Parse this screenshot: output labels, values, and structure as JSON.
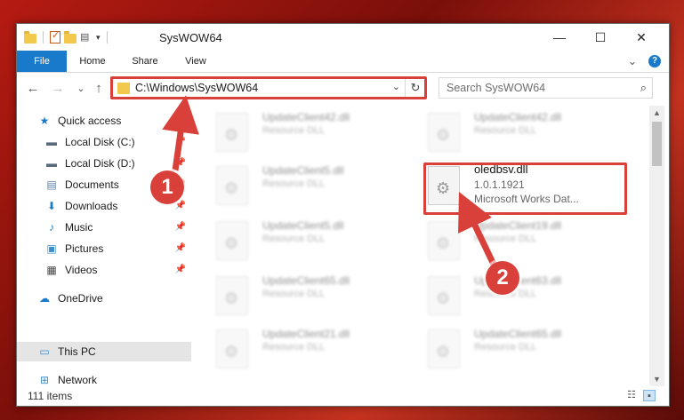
{
  "window": {
    "title": "SysWOW64"
  },
  "window_controls": {
    "minimize": "—",
    "maximize": "☐",
    "close": "✕"
  },
  "ribbon": {
    "tabs": [
      "File",
      "Home",
      "Share",
      "View"
    ],
    "expand_glyph": "⌄",
    "help_glyph": "?"
  },
  "nav": {
    "back": "←",
    "forward": "→",
    "recent": "⌄",
    "up": "↑"
  },
  "address": {
    "path": "C:\\Windows\\SysWOW64",
    "dropdown": "⌄",
    "refresh": "↻"
  },
  "search": {
    "placeholder": "Search SysWOW64",
    "icon": "⌕"
  },
  "sidebar": {
    "items": [
      {
        "label": "Quick access",
        "icon": "star-icon",
        "glyph": "★",
        "color": "#1979ca"
      },
      {
        "label": "Local Disk (C:)",
        "icon": "drive-icon",
        "glyph": "▬",
        "color": "#5a6b7a",
        "pinned": "📌"
      },
      {
        "label": "Local Disk (D:)",
        "icon": "drive-icon",
        "glyph": "▬",
        "color": "#5a6b7a",
        "pinned": "📌"
      },
      {
        "label": "Documents",
        "icon": "documents-icon",
        "glyph": "▤",
        "color": "#5b7fa6",
        "pinned": "📌"
      },
      {
        "label": "Downloads",
        "icon": "download-icon",
        "glyph": "⬇",
        "color": "#1979ca",
        "pinned": "📌"
      },
      {
        "label": "Music",
        "icon": "music-icon",
        "glyph": "♪",
        "color": "#1979ca",
        "pinned": "📌"
      },
      {
        "label": "Pictures",
        "icon": "pictures-icon",
        "glyph": "▣",
        "color": "#3a8fd0",
        "pinned": "📌"
      },
      {
        "label": "Videos",
        "icon": "videos-icon",
        "glyph": "▦",
        "color": "#444",
        "pinned": "📌"
      },
      {
        "label": "OneDrive",
        "icon": "cloud-icon",
        "glyph": "☁",
        "color": "#1979ca"
      },
      {
        "label": "This PC",
        "icon": "computer-icon",
        "glyph": "▭",
        "color": "#3a8fd0"
      },
      {
        "label": "Network",
        "icon": "network-icon",
        "glyph": "⊞",
        "color": "#3a8fd0"
      }
    ]
  },
  "files": {
    "left": [
      {
        "name": "UpdateClient42.dll",
        "desc": "Resource DLL"
      },
      {
        "name": "UpdateClient5.dll",
        "desc": "Resource DLL"
      },
      {
        "name": "UpdateClient5.dll",
        "desc": "Resource DLL"
      },
      {
        "name": "UpdateClient65.dll",
        "desc": "Resource DLL"
      },
      {
        "name": "UpdateClient21.dll",
        "desc": "Resource DLL"
      }
    ],
    "right": [
      {
        "name": "UpdateClient42.dll",
        "desc": "Resource DLL"
      },
      {
        "name": "UpdateClient19.dll",
        "desc": "Resource DLL"
      },
      {
        "name": "UpdateClient63.dll",
        "desc": "Resource DLL"
      },
      {
        "name": "UpdateClient65.dll",
        "desc": "Resource DLL"
      }
    ],
    "target": {
      "name": "oledbsv.dll",
      "version": "1.0.1.1921",
      "desc": "Microsoft Works Dat..."
    }
  },
  "status": {
    "count": "111 items"
  },
  "callouts": [
    "1",
    "2"
  ],
  "colors": {
    "accent": "#1979ca",
    "highlight": "#d9403a"
  }
}
